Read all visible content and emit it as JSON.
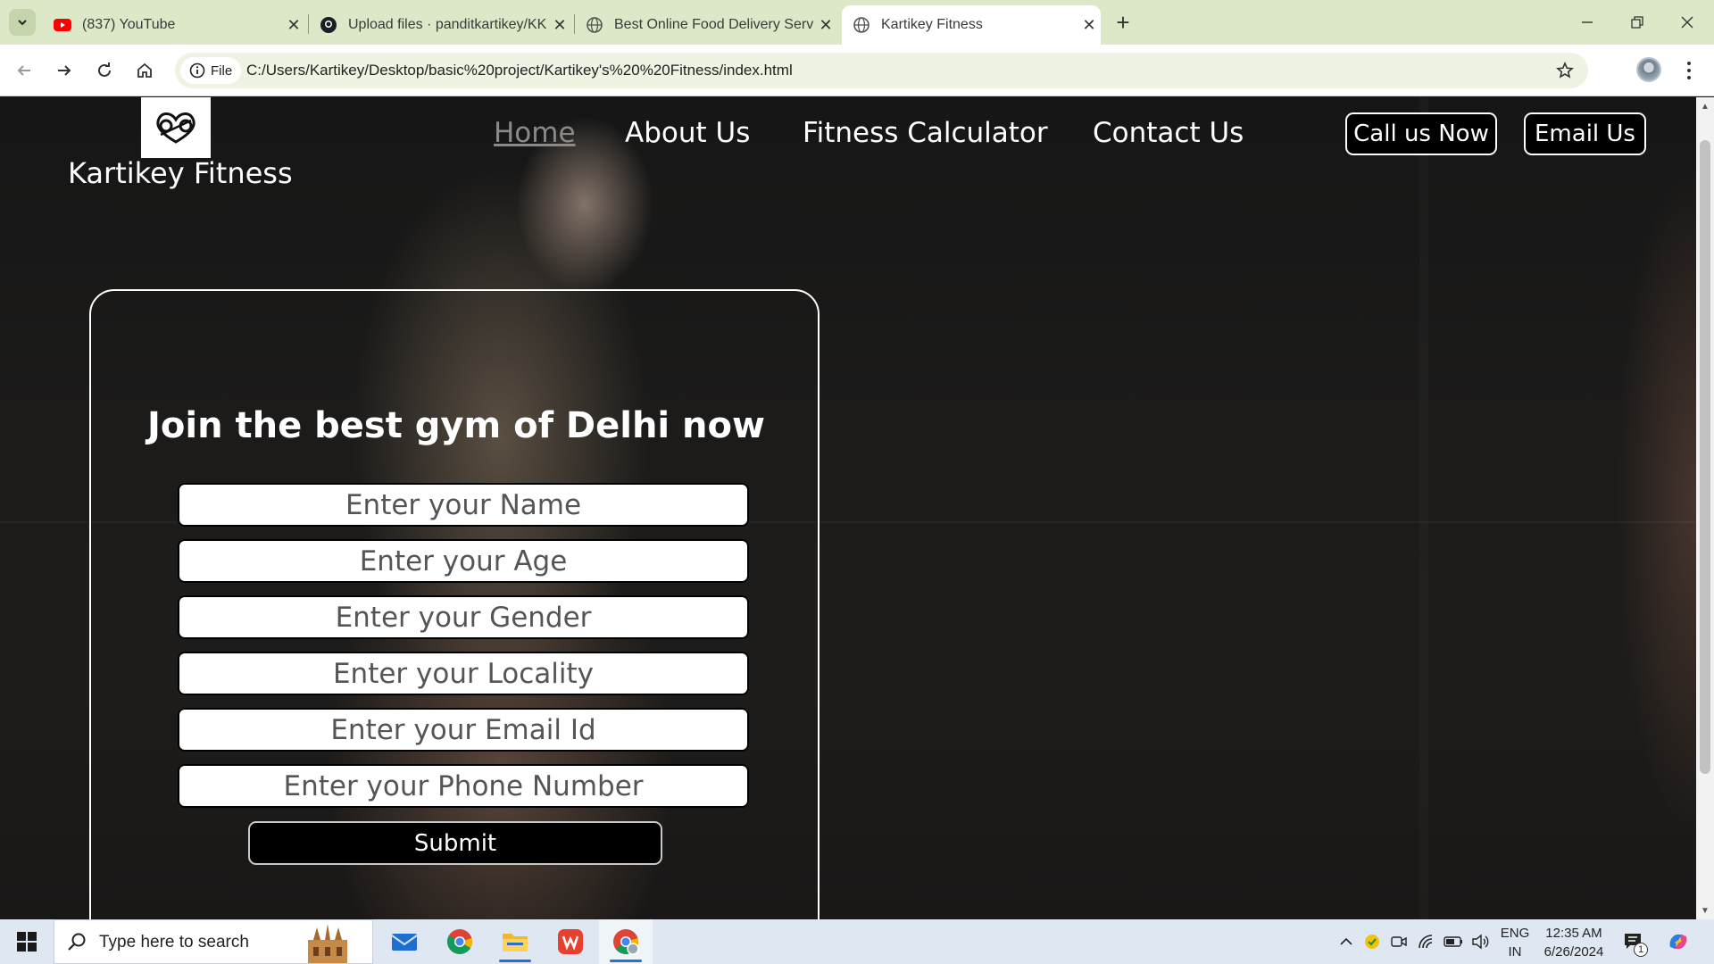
{
  "browser": {
    "tabs": [
      {
        "title": "(837) YouTube",
        "icon": "youtube-icon"
      },
      {
        "title": "Upload files · panditkartikey/KK",
        "icon": "github-icon"
      },
      {
        "title": "Best Online Food Delivery Servi",
        "icon": "globe-icon"
      },
      {
        "title": "Kartikey Fitness",
        "icon": "globe-icon",
        "active": true
      }
    ],
    "site_info_label": "File",
    "url": "C:/Users/Kartikey/Desktop/basic%20project/Kartikey's%20%20Fitness/index.html",
    "theme_color": "#dde8c8"
  },
  "site": {
    "brand": "Kartikey Fitness",
    "nav": {
      "home": "Home",
      "about": "About Us",
      "calculator": "Fitness Calculator",
      "contact": "Contact Us"
    },
    "buttons": {
      "call": "Call us Now",
      "email": "Email Us"
    },
    "form": {
      "heading": "Join the best gym of Delhi now",
      "name_placeholder": "Enter your Name",
      "age_placeholder": "Enter your Age",
      "gender_placeholder": "Enter your Gender",
      "locality_placeholder": "Enter your Locality",
      "email_placeholder": "Enter your Email Id",
      "phone_placeholder": "Enter your Phone Number",
      "submit": "Submit"
    }
  },
  "taskbar": {
    "search_placeholder": "Type here to search",
    "lang_line1": "ENG",
    "lang_line2": "IN",
    "time": "12:35 AM",
    "date": "6/26/2024",
    "notification_count": "1"
  }
}
